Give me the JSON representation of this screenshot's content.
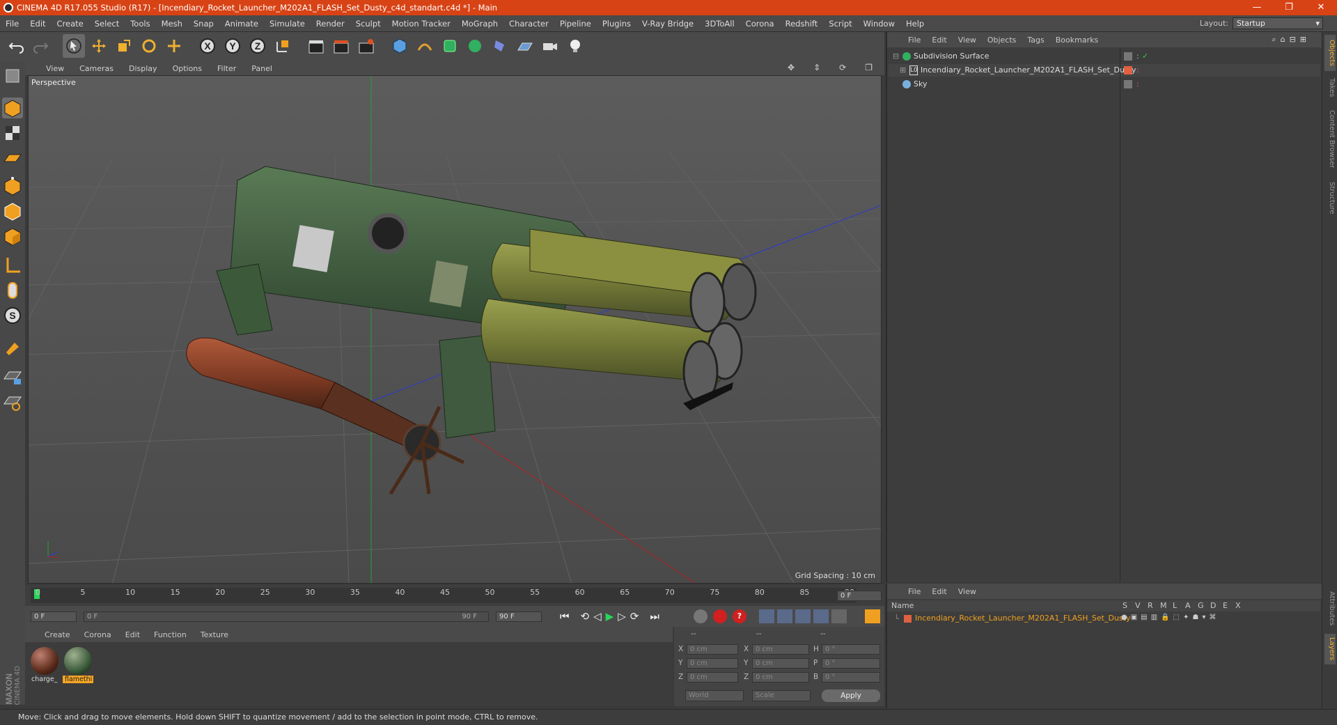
{
  "window": {
    "title": "CINEMA 4D R17.055 Studio (R17) - [Incendiary_Rocket_Launcher_M202A1_FLASH_Set_Dusty_c4d_standart.c4d *] - Main",
    "minimize": "—",
    "restore": "❐",
    "close": "✕"
  },
  "menu": [
    "File",
    "Edit",
    "Create",
    "Select",
    "Tools",
    "Mesh",
    "Snap",
    "Animate",
    "Simulate",
    "Render",
    "Sculpt",
    "Motion Tracker",
    "MoGraph",
    "Character",
    "Pipeline",
    "Plugins",
    "V-Ray Bridge",
    "3DToAll",
    "Corona",
    "Redshift",
    "Script",
    "Window",
    "Help"
  ],
  "layout": {
    "label": "Layout:",
    "value": "Startup"
  },
  "viewport": {
    "menu": [
      "View",
      "Cameras",
      "Display",
      "Options",
      "Filter",
      "Panel"
    ],
    "label": "Perspective",
    "grid_spacing": "Grid Spacing : 10 cm"
  },
  "timeline": {
    "ticks": [
      "0",
      "5",
      "10",
      "15",
      "20",
      "25",
      "30",
      "35",
      "40",
      "45",
      "50",
      "55",
      "60",
      "65",
      "70",
      "75",
      "80",
      "85",
      "90"
    ],
    "current_frame": "0 F"
  },
  "anim": {
    "start": "0 F",
    "range_start": "0 F",
    "range_end": "90 F",
    "end": "90 F"
  },
  "materials": {
    "menu": [
      "Create",
      "Corona",
      "Edit",
      "Function",
      "Texture"
    ],
    "items": [
      {
        "name": "charge_",
        "selected": false
      },
      {
        "name": "flamethi",
        "selected": true
      }
    ]
  },
  "coords": {
    "headers": [
      "--",
      "--",
      "--"
    ],
    "rows": [
      {
        "a": "X",
        "av": "0 cm",
        "b": "X",
        "bv": "0 cm",
        "c": "H",
        "cv": "0 °"
      },
      {
        "a": "Y",
        "av": "0 cm",
        "b": "Y",
        "bv": "0 cm",
        "c": "P",
        "cv": "0 °"
      },
      {
        "a": "Z",
        "av": "0 cm",
        "b": "Z",
        "bv": "0 cm",
        "c": "B",
        "cv": "0 °"
      }
    ],
    "mode1": "World",
    "mode2": "Scale",
    "apply": "Apply"
  },
  "objects": {
    "menu": [
      "File",
      "Edit",
      "View",
      "Objects",
      "Tags",
      "Bookmarks"
    ],
    "items": [
      {
        "name": "Subdivision Surface"
      },
      {
        "name": "Incendiary_Rocket_Launcher_M202A1_FLASH_Set_Dusty"
      },
      {
        "name": "Sky"
      }
    ]
  },
  "layers": {
    "menu": [
      "File",
      "Edit",
      "View"
    ],
    "name_header": "Name",
    "cols": [
      "S",
      "V",
      "R",
      "M",
      "L",
      "A",
      "G",
      "D",
      "E",
      "X"
    ],
    "row": "Incendiary_Rocket_Launcher_M202A1_FLASH_Set_Dusty"
  },
  "side_tabs": [
    "Objects",
    "Takes",
    "Content Browser",
    "Structure"
  ],
  "side_tabs_bottom": [
    "Attributes",
    "Layers"
  ],
  "brand": {
    "line1": "MAXON",
    "line2": "CINEMA 4D"
  },
  "status": "Move: Click and drag to move elements. Hold down SHIFT to quantize movement / add to the selection in point mode, CTRL to remove."
}
